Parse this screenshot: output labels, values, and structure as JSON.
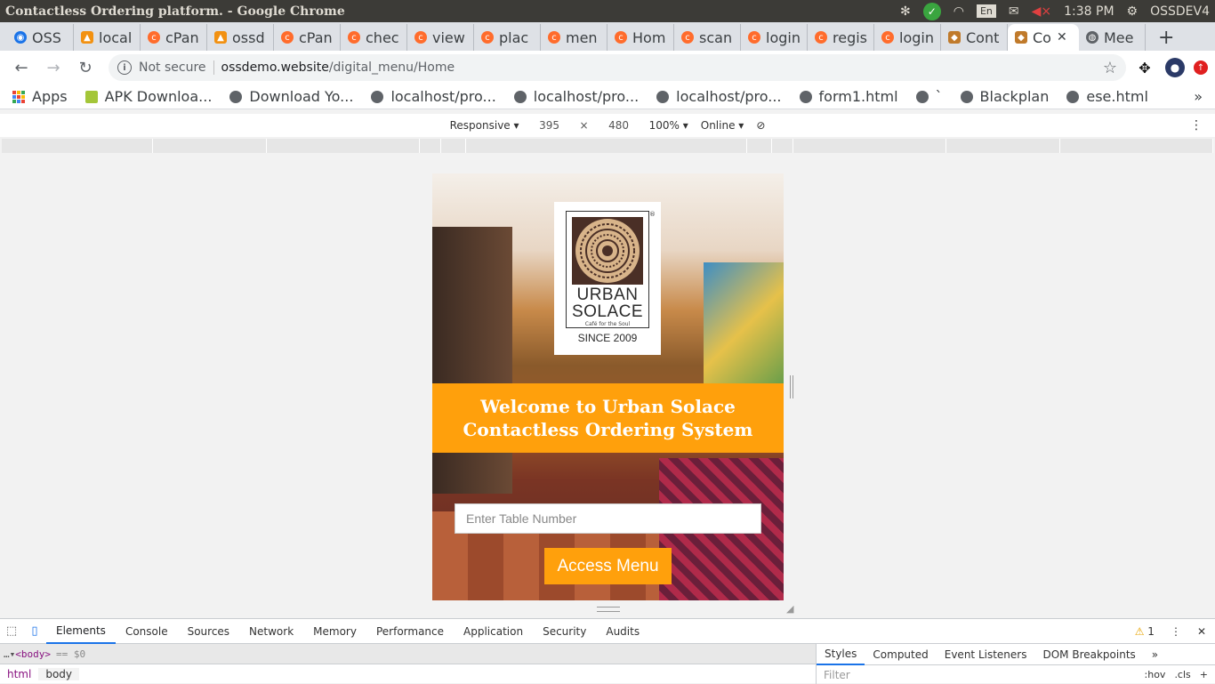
{
  "system_bar": {
    "title": "Contactless Ordering platform. - Google Chrome",
    "lang": "En",
    "time": "1:38 PM",
    "user": "OSSDEV4"
  },
  "tabs": [
    {
      "label": "OSS",
      "icon": "oss-icon"
    },
    {
      "label": "local",
      "icon": "pma-icon"
    },
    {
      "label": "cPan",
      "icon": "cpanel-icon"
    },
    {
      "label": "ossd",
      "icon": "pma-icon"
    },
    {
      "label": "cPan",
      "icon": "cpanel-icon"
    },
    {
      "label": "chec",
      "icon": "cpanel-icon"
    },
    {
      "label": "view",
      "icon": "cpanel-icon"
    },
    {
      "label": "plac",
      "icon": "cpanel-icon"
    },
    {
      "label": "men",
      "icon": "cpanel-icon"
    },
    {
      "label": "Hom",
      "icon": "cpanel-icon"
    },
    {
      "label": "scan",
      "icon": "cpanel-icon"
    },
    {
      "label": "login",
      "icon": "cpanel-icon"
    },
    {
      "label": "regis",
      "icon": "cpanel-icon"
    },
    {
      "label": "login",
      "icon": "cpanel-icon"
    },
    {
      "label": "Cont",
      "icon": "tiger-icon"
    },
    {
      "label": "Co",
      "icon": "tiger-icon",
      "active": true
    },
    {
      "label": "Mee",
      "icon": "globe-icon"
    }
  ],
  "toolbar": {
    "security_label": "Not secure",
    "url_host": "ossdemo.website",
    "url_path": "/digital_menu/Home"
  },
  "bookmarks": [
    {
      "label": "Apps",
      "icon": "apps-grid-icon"
    },
    {
      "label": "APK Downloa...",
      "icon": "apk-icon"
    },
    {
      "label": "Download Yo...",
      "icon": "globe-icon"
    },
    {
      "label": "localhost/pro...",
      "icon": "globe-icon"
    },
    {
      "label": "localhost/pro...",
      "icon": "globe-icon"
    },
    {
      "label": "localhost/pro...",
      "icon": "globe-icon"
    },
    {
      "label": "form1.html",
      "icon": "globe-icon"
    },
    {
      "label": "`",
      "icon": "globe-icon"
    },
    {
      "label": "Blackplan",
      "icon": "globe-icon"
    },
    {
      "label": "ese.html",
      "icon": "globe-icon"
    }
  ],
  "device_toolbar": {
    "mode": "Responsive",
    "width": "395",
    "x": "×",
    "height": "480",
    "zoom": "100%",
    "network": "Online"
  },
  "page": {
    "logo_line1": "URBAN",
    "logo_line2": "SOLACE",
    "logo_tagline": "Café for the Soul",
    "logo_since": "SINCE 2009",
    "welcome_line1": "Welcome to Urban Solace",
    "welcome_line2": "Contactless Ordering System",
    "table_placeholder": "Enter Table Number",
    "access_button": "Access Menu",
    "accent_color": "#ffa00c"
  },
  "devtools": {
    "tabs": [
      "Elements",
      "Console",
      "Sources",
      "Network",
      "Memory",
      "Performance",
      "Application",
      "Security",
      "Audits"
    ],
    "active_tab": "Elements",
    "warnings": "1",
    "dom_line": "<body>",
    "dom_eq": "== $0",
    "breadcrumbs": [
      "html",
      "body"
    ],
    "side_tabs": [
      "Styles",
      "Computed",
      "Event Listeners",
      "DOM Breakpoints"
    ],
    "filter_placeholder": "Filter",
    "filter_tools": [
      ":hov",
      ".cls",
      "+"
    ]
  }
}
